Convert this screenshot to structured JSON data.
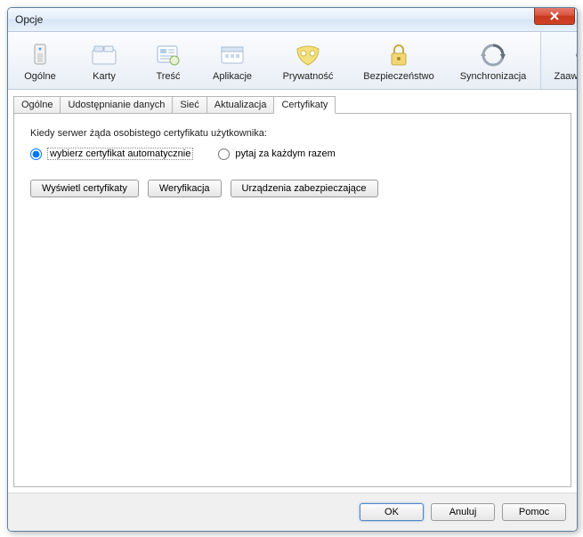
{
  "window": {
    "title": "Opcje"
  },
  "toolbar": {
    "items": [
      {
        "label": "Ogólne"
      },
      {
        "label": "Karty"
      },
      {
        "label": "Treść"
      },
      {
        "label": "Aplikacje"
      },
      {
        "label": "Prywatność"
      },
      {
        "label": "Bezpieczeństwo"
      },
      {
        "label": "Synchronizacja"
      },
      {
        "label": "Zaawansowane"
      }
    ],
    "active": 7
  },
  "tabs": {
    "items": [
      {
        "label": "Ogólne"
      },
      {
        "label": "Udostępnianie danych"
      },
      {
        "label": "Sieć"
      },
      {
        "label": "Aktualizacja"
      },
      {
        "label": "Certyfikaty"
      }
    ],
    "active": 4
  },
  "content": {
    "prompt": "Kiedy serwer żąda osobistego certyfikatu użytkownika:",
    "radio_auto": "wybierz certyfikat automatycznie",
    "radio_ask": "pytaj za każdym razem",
    "selected": "auto",
    "btn_show": "Wyświetl certyfikaty",
    "btn_verify": "Weryfikacja",
    "btn_devices": "Urządzenia zabezpieczające"
  },
  "footer": {
    "ok": "OK",
    "cancel": "Anuluj",
    "help": "Pomoc"
  }
}
